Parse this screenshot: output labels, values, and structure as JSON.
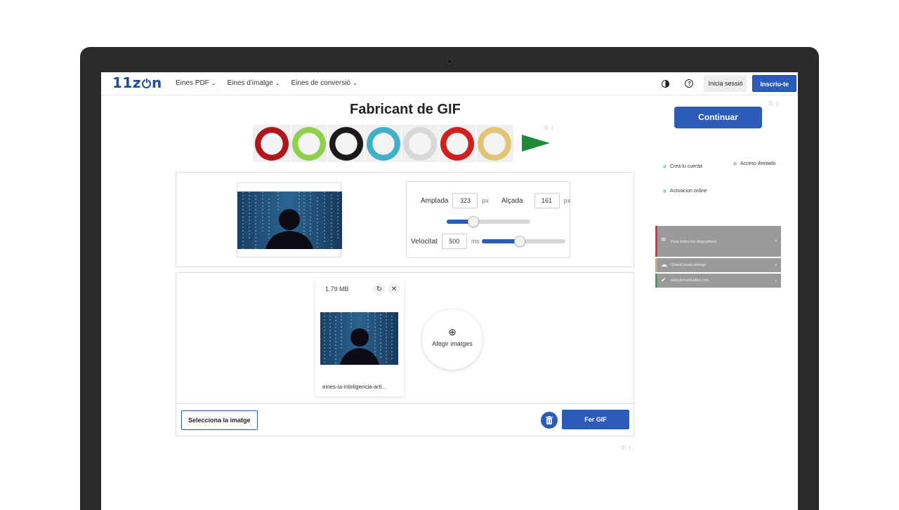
{
  "header": {
    "logo": "11zon",
    "nav": [
      {
        "label": "Eines PDF"
      },
      {
        "label": "Eines d'imatge"
      },
      {
        "label": "Eines de conversió"
      }
    ],
    "login_label": "Inicia sessió",
    "signup_label": "Inscriu-te"
  },
  "page": {
    "title": "Fabricant de GIF"
  },
  "ad_top": {
    "plate_colors": [
      "#b3161a",
      "#8fcf4a",
      "#1a1a1a",
      "#3fb0c8",
      "#d8d8d8",
      "#d11f1f",
      "#e0c574"
    ],
    "info_label": "ⓘ ⋮"
  },
  "settings": {
    "width_label": "Amplada",
    "width_value": "323",
    "width_unit": "px",
    "height_label": "Alçada",
    "height_value": "161",
    "height_unit": "px",
    "size_slider_level": 0.32,
    "speed_label": "Velocitat",
    "speed_value": "500",
    "speed_unit": "ms",
    "speed_slider_level": 0.45
  },
  "file": {
    "size": "1.79 MB",
    "name": "eines-ia-inteligencia-arti..."
  },
  "add_images_label": "Afegir imatges",
  "actions": {
    "select_label": "Selecciona la imatge",
    "make_label": "Fer GIF"
  },
  "side_ad": {
    "continue_label": "Continuar",
    "features": [
      "Crea tu cuenta",
      "Acceso ilimitado",
      "Activacion online"
    ],
    "rows": [
      {
        "label": "Para todos los dispositivos",
        "accent": "#d23a3a"
      },
      {
        "label": "Global cloud storage",
        "accent": "#c9b06a"
      },
      {
        "label": "webstorrentoutlet.com",
        "accent": "#3aa845"
      }
    ],
    "info_label": "ⓘ ⋮"
  },
  "colors": {
    "primary": "#2a5cb8",
    "logo": "#1f4c9a"
  }
}
